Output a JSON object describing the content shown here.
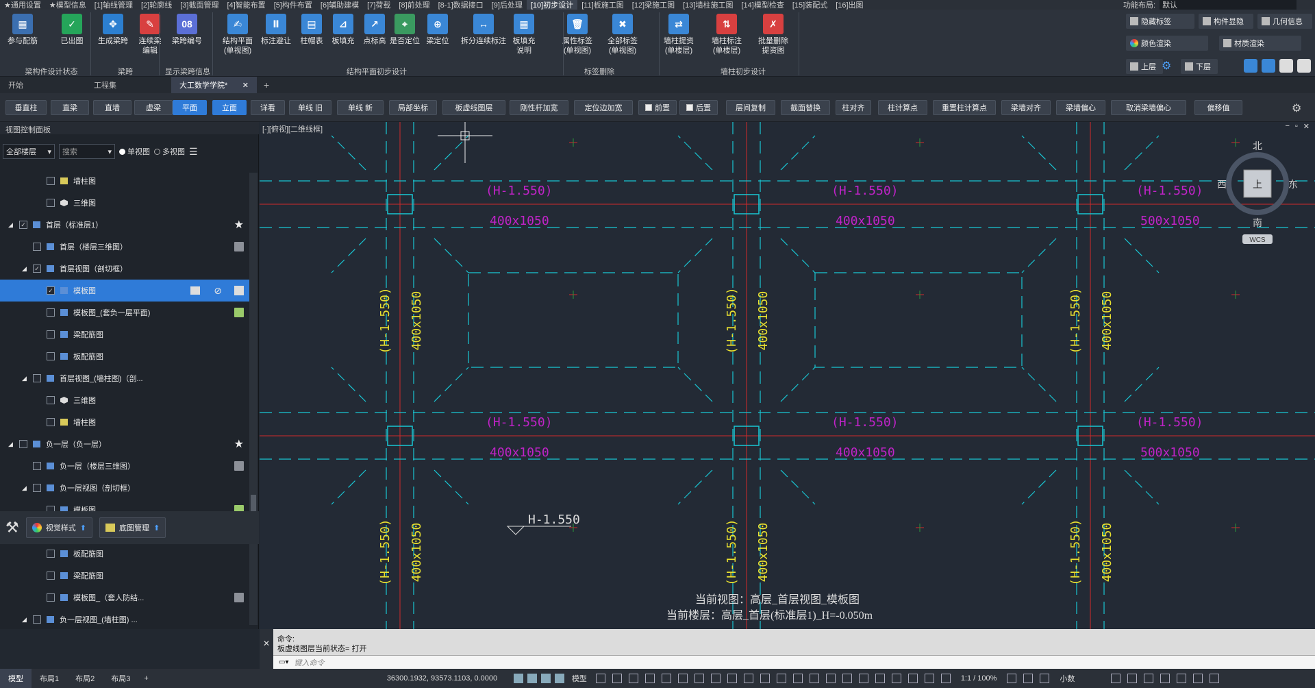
{
  "menu": [
    "★通用设置",
    "★模型信息",
    "[1]轴线管理",
    "[2]轮廓线",
    "[3]截面管理",
    "[4]智能布置",
    "[5]构件布置",
    "[6]辅助建模",
    "[7]荷载",
    "[8]前处理",
    "[8-1]数据接口",
    "[9]后处理",
    "[10]初步设计",
    "[11]板施工图",
    "[12]梁施工图",
    "[13]墙柱施工图",
    "[14]模型检查",
    "[15]装配式",
    "[16]出图"
  ],
  "menu_active": "[10]初步设计",
  "menu_right": {
    "label": "功能布局:",
    "value": "默认"
  },
  "ribbon": {
    "buttons": [
      {
        "label": "参与配筋",
        "color": "#3b6fb0",
        "glyph": "▦"
      },
      {
        "label": "已出图",
        "color": "#25a55a",
        "glyph": "✓"
      },
      {
        "label": "生成梁跨",
        "color": "#2c7fd0",
        "glyph": "✥"
      },
      {
        "label": "连续梁\n编辑",
        "color": "#d84040",
        "glyph": "✎"
      },
      {
        "label": "梁跨编号",
        "color": "#5b6fd6",
        "glyph": "08"
      },
      {
        "label": "结构平面\n(单视图)",
        "color": "#3a87d6",
        "glyph": "✍"
      },
      {
        "label": "标注避让",
        "color": "#3a87d6",
        "glyph": "Ⅱ"
      },
      {
        "label": "柱帽表",
        "color": "#3a87d6",
        "glyph": "▤"
      },
      {
        "label": "板填充",
        "color": "#3a87d6",
        "glyph": "⊿"
      },
      {
        "label": "点标高",
        "color": "#3a87d6",
        "glyph": "↗"
      },
      {
        "label": "是否定位",
        "color": "#3a9a60",
        "glyph": "⌖"
      },
      {
        "label": "梁定位",
        "color": "#3a87d6",
        "glyph": "⊕"
      },
      {
        "label": "拆分连续标注",
        "color": "#3a87d6",
        "glyph": "↔"
      },
      {
        "label": "板填充\n说明",
        "color": "#3a87d6",
        "glyph": "▦"
      },
      {
        "label": "属性标签\n(单视图)",
        "color": "#3a87d6",
        "glyph": "🗑"
      },
      {
        "label": "全部标签\n(单视图)",
        "color": "#3a87d6",
        "glyph": "✖"
      },
      {
        "label": "墙柱提资\n(单楼层)",
        "color": "#3a87d6",
        "glyph": "⇄"
      },
      {
        "label": "墙柱标注\n(单楼层)",
        "color": "#d84040",
        "glyph": "⇅"
      },
      {
        "label": "批量删除\n提资图",
        "color": "#d84040",
        "glyph": "✗"
      }
    ],
    "groups": [
      "梁构件设计状态",
      "梁跨",
      "显示梁跨信息",
      "结构平面初步设计",
      "标签删除",
      "墙柱初步设计"
    ],
    "right": [
      "隐藏标签",
      "构件显隐",
      "几何信息",
      "颜色渲染",
      "材质渲染",
      "上层",
      "下层"
    ]
  },
  "doc_tabs": [
    "开始",
    "工程集",
    "大工数学学院*"
  ],
  "doc_tab_active": "大工数学学院*",
  "tools": [
    "垂直柱",
    "直梁",
    "直墙",
    "虚梁",
    "平面",
    "立面",
    "详看",
    "单线 旧",
    "单线 新",
    "局部坐标",
    "板虚线图层",
    "刚性杆加宽",
    "定位边加宽",
    "前置",
    "后置",
    "层间复制",
    "截面替换",
    "柱对齐",
    "柱计算点",
    "重置柱计算点",
    "梁墙对齐",
    "梁墙偏心",
    "取消梁墙偏心",
    "偏移值"
  ],
  "tools_selected": [
    "平面",
    "立面"
  ],
  "left_panel": {
    "title": "视图控制面板",
    "floor_select": "全部楼层",
    "search_placeholder": "搜索",
    "view_single": "单视图",
    "view_multi": "多视图",
    "tree": [
      {
        "label": "墙柱图",
        "indent": 3,
        "icon": "yellow"
      },
      {
        "label": "三维图",
        "indent": 3,
        "icon": "cube"
      },
      {
        "label": "首层（标准层1）",
        "indent": 1,
        "star": true,
        "expand": true,
        "checked": true
      },
      {
        "label": "首层（楼层三维图）",
        "indent": 2,
        "tail": "gray"
      },
      {
        "label": "首层视图（剖切框）",
        "indent": 2,
        "expand": true,
        "checked": true
      },
      {
        "label": "模板图",
        "indent": 3,
        "selected": true,
        "checked": true
      },
      {
        "label": "模板图_(套负一层平面)",
        "indent": 3,
        "tail": "img"
      },
      {
        "label": "梁配筋图",
        "indent": 3
      },
      {
        "label": "板配筋图",
        "indent": 3
      },
      {
        "label": "首层视图_(墙柱图)（剖...",
        "indent": 2,
        "expand": true
      },
      {
        "label": "三维图",
        "indent": 3,
        "icon": "cube"
      },
      {
        "label": "墙柱图",
        "indent": 3,
        "icon": "yellow"
      },
      {
        "label": "负一层（负一层）",
        "indent": 1,
        "star": true,
        "expand": true
      },
      {
        "label": "负一层（楼层三维图）",
        "indent": 2,
        "tail": "gray"
      },
      {
        "label": "负一层视图（剖切框）",
        "indent": 2,
        "expand": true
      },
      {
        "label": "模板图",
        "indent": 3,
        "tail": "img"
      },
      {
        "label": "模板图_(套负一层平面)",
        "indent": 3,
        "tail": "img"
      },
      {
        "label": "板配筋图",
        "indent": 3
      },
      {
        "label": "梁配筋图",
        "indent": 3
      },
      {
        "label": "模板图_（套人防结...",
        "indent": 3,
        "tail": "gray"
      },
      {
        "label": "负一层视图_(墙柱图) ...",
        "indent": 2,
        "expand": true
      }
    ],
    "bottom": [
      "视觉样式",
      "底图管理"
    ]
  },
  "canvas": {
    "viewport_label": "[-][俯视][二维线框]",
    "compass": {
      "n": "北",
      "s": "南",
      "e": "东",
      "w": "西",
      "center": "上",
      "wcs": "WCS"
    },
    "beam_labels_h": [
      {
        "elev": "(H-1.550)",
        "size": "400x1050"
      },
      {
        "elev": "(H-1.550)",
        "size": "400x1050"
      },
      {
        "elev": "(H-1.550)",
        "size": "500x1050"
      }
    ],
    "beam_labels_v": [
      {
        "elev": "(H-1.550)",
        "size": "400x1050"
      }
    ],
    "level_mark": "H-1.550",
    "info_line1": "当前视图：高层_首层视图_模板图",
    "info_line2": "当前楼层：高层_首层(标准层1)_H=-0.050m"
  },
  "command": {
    "line1": "命令:",
    "line2": "板虚线图层当前状态= 打开",
    "placeholder": "键入命令"
  },
  "status": {
    "layout_tabs": [
      "模型",
      "布局1",
      "布局2",
      "布局3"
    ],
    "coords": "36300.1932, 93573.1103, 0.0000",
    "model": "模型",
    "scale": "1:1 / 100%",
    "decimal": "小数"
  }
}
